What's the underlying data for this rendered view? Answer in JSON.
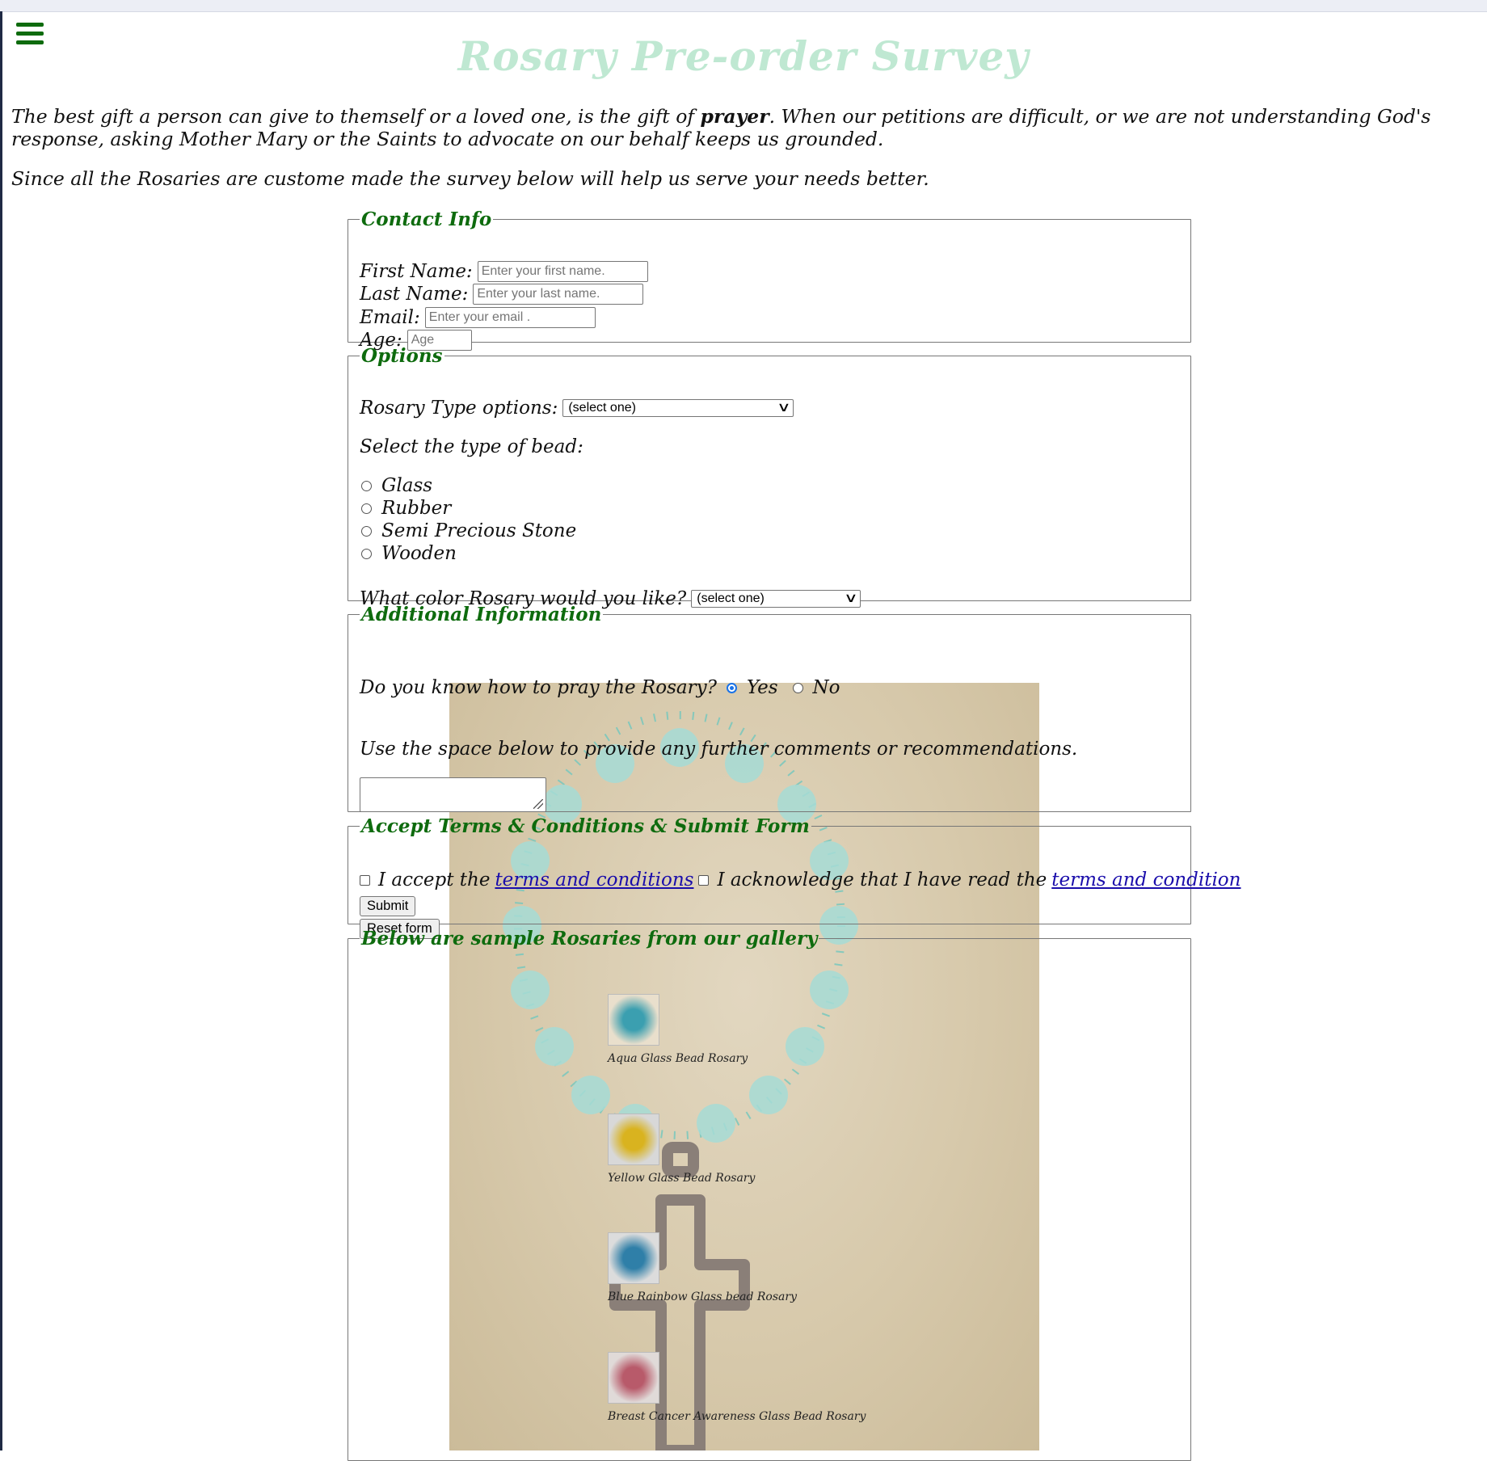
{
  "page": {
    "title": "Rosary Pre-order Survey",
    "intro_pre": "The best gift a person can give to themself or a loved one, is the gift of ",
    "intro_bold": "prayer",
    "intro_post": ". When our petitions are difficult, or we are not understanding God's response, asking Mother Mary or the Saints to advocate on our behalf keeps us grounded.",
    "intro2": "Since all the Rosaries are custome made the survey below will help us serve your needs better."
  },
  "contact": {
    "legend": "Contact Info",
    "first_name_label": "First Name:",
    "first_name_placeholder": "Enter your first name.",
    "last_name_label": "Last Name:",
    "last_name_placeholder": "Enter your last name.",
    "email_label": "Email:",
    "email_placeholder": "Enter your email .",
    "age_label": "Age:",
    "age_placeholder": "Age"
  },
  "options": {
    "legend": "Options",
    "rosary_type_label": "Rosary Type options:",
    "rosary_type_value": "(select one)",
    "bead_label": "Select the type of bead:",
    "beads": [
      "Glass",
      "Rubber",
      "Semi Precious Stone",
      "Wooden"
    ],
    "color_label": "What color Rosary would you like?",
    "color_value": "(select one)"
  },
  "additional": {
    "legend": "Additional Information",
    "pray_question": "Do you know how to pray the Rosary?",
    "yes_label": "Yes",
    "no_label": "No",
    "selected": "Yes",
    "comments_label": "Use the space below to provide any further comments or recommendations."
  },
  "terms": {
    "legend": "Accept Terms & Conditions & Submit Form",
    "accept_pre": "I accept the",
    "accept_link": "terms and conditions",
    "ack_pre": "I acknowledge that I have read the",
    "ack_link": "terms and condition",
    "submit_label": "Submit",
    "reset_label": "Reset form"
  },
  "gallery": {
    "legend": "Below are sample Rosaries from our gallery",
    "items": [
      {
        "caption": "Aqua Glass Bead Rosary",
        "color": "#3b9fb0"
      },
      {
        "caption": "Yellow Glass Bead Rosary",
        "color": "#d9b31f"
      },
      {
        "caption": "Blue Rainbow Glass bead Rosary",
        "color": "#2f7fa8"
      },
      {
        "caption": "Breast Cancer Awareness Glass Bead Rosary",
        "color": "#b85a6a"
      }
    ]
  },
  "colors": {
    "accent_green": "#0e6b0e",
    "title_green": "#bfe8d2",
    "link_blue": "#1a0dab"
  }
}
